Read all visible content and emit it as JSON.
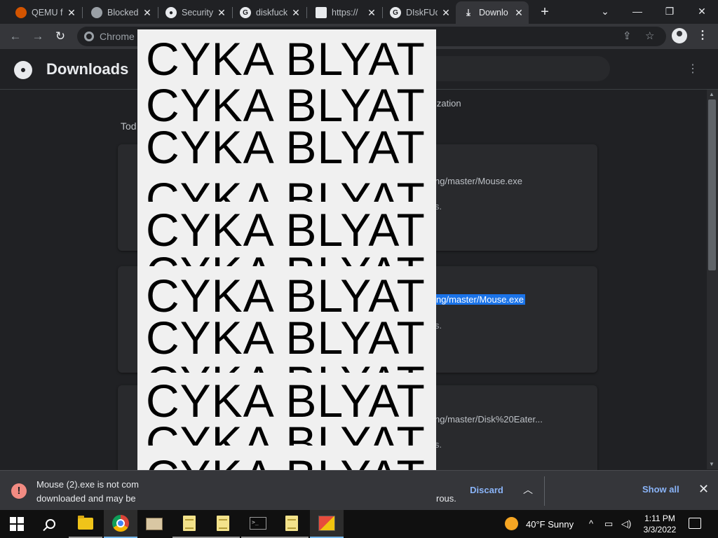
{
  "tabs": [
    {
      "title": "QEMU f",
      "icon": "qemu-icon"
    },
    {
      "title": "Blocked",
      "icon": "globe-icon"
    },
    {
      "title": "Security",
      "icon": "github-icon"
    },
    {
      "title": "diskfuck",
      "icon": "google-icon"
    },
    {
      "title": "https://",
      "icon": "site-icon"
    },
    {
      "title": "DIskFUc",
      "icon": "google-icon"
    },
    {
      "title": "Downlo",
      "icon": "download-icon",
      "active": true
    }
  ],
  "toolbar": {
    "omnibox_text": "Chrome"
  },
  "page": {
    "title": "Downloads",
    "section_today": "Tod",
    "notice_fragment": "ization",
    "items": [
      {
        "url_fragment": "ng/master/Mouse.exe",
        "status_fragment": "s.",
        "selected": false
      },
      {
        "url_fragment": "ng/master/Mouse.exe",
        "status_fragment": "s.",
        "selected": true
      },
      {
        "url_fragment": "ng/master/Disk%20Eater...",
        "status_fragment": "s.",
        "selected": false
      }
    ]
  },
  "overlay": {
    "lines": [
      "CYKA BLYAT",
      "CYKA BLYAT",
      "CYKA BLYAT",
      "CYKA BLYAT",
      "CYKA BLYAT",
      "CYKA BLYAT",
      "CYKA BLYAT",
      "CYKA BLYAT",
      "CYKA BLYAT",
      "CYKA BLYAT",
      "CYKA BLYAT",
      "CYKA BLYAT"
    ]
  },
  "shelf": {
    "line1": "Mouse (2).exe is not com",
    "line2": "downloaded and may be",
    "line2_end": "rous.",
    "discard_label": "Discard",
    "show_all_label": "Show all"
  },
  "taskbar": {
    "weather": "40°F  Sunny",
    "time": "1:11 PM",
    "date": "3/3/2022"
  },
  "colors": {
    "accent_blue": "#8ab4f8",
    "warning_red": "#f28b82",
    "selection_blue": "#1a73e8"
  }
}
